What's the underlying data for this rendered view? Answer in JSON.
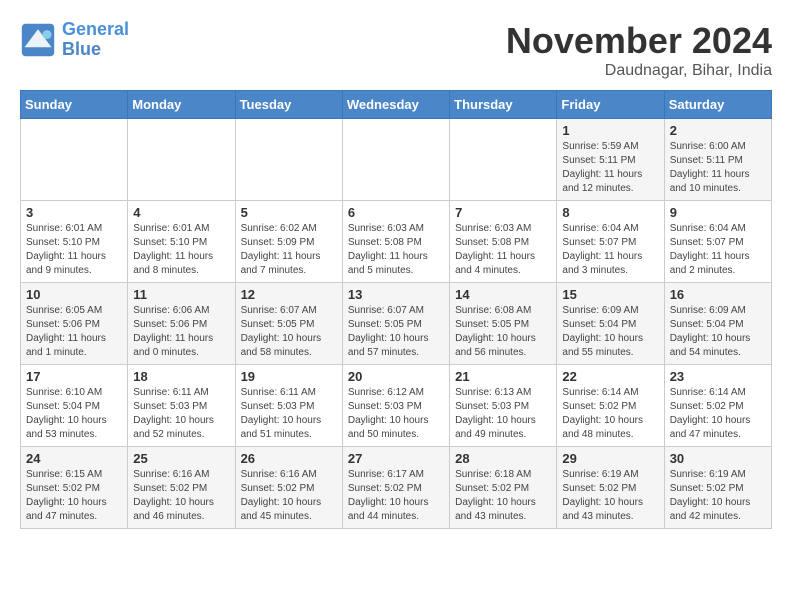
{
  "header": {
    "logo_line1": "General",
    "logo_line2": "Blue",
    "month": "November 2024",
    "location": "Daudnagar, Bihar, India"
  },
  "weekdays": [
    "Sunday",
    "Monday",
    "Tuesday",
    "Wednesday",
    "Thursday",
    "Friday",
    "Saturday"
  ],
  "weeks": [
    [
      {
        "day": "",
        "info": ""
      },
      {
        "day": "",
        "info": ""
      },
      {
        "day": "",
        "info": ""
      },
      {
        "day": "",
        "info": ""
      },
      {
        "day": "",
        "info": ""
      },
      {
        "day": "1",
        "info": "Sunrise: 5:59 AM\nSunset: 5:11 PM\nDaylight: 11 hours\nand 12 minutes."
      },
      {
        "day": "2",
        "info": "Sunrise: 6:00 AM\nSunset: 5:11 PM\nDaylight: 11 hours\nand 10 minutes."
      }
    ],
    [
      {
        "day": "3",
        "info": "Sunrise: 6:01 AM\nSunset: 5:10 PM\nDaylight: 11 hours\nand 9 minutes."
      },
      {
        "day": "4",
        "info": "Sunrise: 6:01 AM\nSunset: 5:10 PM\nDaylight: 11 hours\nand 8 minutes."
      },
      {
        "day": "5",
        "info": "Sunrise: 6:02 AM\nSunset: 5:09 PM\nDaylight: 11 hours\nand 7 minutes."
      },
      {
        "day": "6",
        "info": "Sunrise: 6:03 AM\nSunset: 5:08 PM\nDaylight: 11 hours\nand 5 minutes."
      },
      {
        "day": "7",
        "info": "Sunrise: 6:03 AM\nSunset: 5:08 PM\nDaylight: 11 hours\nand 4 minutes."
      },
      {
        "day": "8",
        "info": "Sunrise: 6:04 AM\nSunset: 5:07 PM\nDaylight: 11 hours\nand 3 minutes."
      },
      {
        "day": "9",
        "info": "Sunrise: 6:04 AM\nSunset: 5:07 PM\nDaylight: 11 hours\nand 2 minutes."
      }
    ],
    [
      {
        "day": "10",
        "info": "Sunrise: 6:05 AM\nSunset: 5:06 PM\nDaylight: 11 hours\nand 1 minute."
      },
      {
        "day": "11",
        "info": "Sunrise: 6:06 AM\nSunset: 5:06 PM\nDaylight: 11 hours\nand 0 minutes."
      },
      {
        "day": "12",
        "info": "Sunrise: 6:07 AM\nSunset: 5:05 PM\nDaylight: 10 hours\nand 58 minutes."
      },
      {
        "day": "13",
        "info": "Sunrise: 6:07 AM\nSunset: 5:05 PM\nDaylight: 10 hours\nand 57 minutes."
      },
      {
        "day": "14",
        "info": "Sunrise: 6:08 AM\nSunset: 5:05 PM\nDaylight: 10 hours\nand 56 minutes."
      },
      {
        "day": "15",
        "info": "Sunrise: 6:09 AM\nSunset: 5:04 PM\nDaylight: 10 hours\nand 55 minutes."
      },
      {
        "day": "16",
        "info": "Sunrise: 6:09 AM\nSunset: 5:04 PM\nDaylight: 10 hours\nand 54 minutes."
      }
    ],
    [
      {
        "day": "17",
        "info": "Sunrise: 6:10 AM\nSunset: 5:04 PM\nDaylight: 10 hours\nand 53 minutes."
      },
      {
        "day": "18",
        "info": "Sunrise: 6:11 AM\nSunset: 5:03 PM\nDaylight: 10 hours\nand 52 minutes."
      },
      {
        "day": "19",
        "info": "Sunrise: 6:11 AM\nSunset: 5:03 PM\nDaylight: 10 hours\nand 51 minutes."
      },
      {
        "day": "20",
        "info": "Sunrise: 6:12 AM\nSunset: 5:03 PM\nDaylight: 10 hours\nand 50 minutes."
      },
      {
        "day": "21",
        "info": "Sunrise: 6:13 AM\nSunset: 5:03 PM\nDaylight: 10 hours\nand 49 minutes."
      },
      {
        "day": "22",
        "info": "Sunrise: 6:14 AM\nSunset: 5:02 PM\nDaylight: 10 hours\nand 48 minutes."
      },
      {
        "day": "23",
        "info": "Sunrise: 6:14 AM\nSunset: 5:02 PM\nDaylight: 10 hours\nand 47 minutes."
      }
    ],
    [
      {
        "day": "24",
        "info": "Sunrise: 6:15 AM\nSunset: 5:02 PM\nDaylight: 10 hours\nand 47 minutes."
      },
      {
        "day": "25",
        "info": "Sunrise: 6:16 AM\nSunset: 5:02 PM\nDaylight: 10 hours\nand 46 minutes."
      },
      {
        "day": "26",
        "info": "Sunrise: 6:16 AM\nSunset: 5:02 PM\nDaylight: 10 hours\nand 45 minutes."
      },
      {
        "day": "27",
        "info": "Sunrise: 6:17 AM\nSunset: 5:02 PM\nDaylight: 10 hours\nand 44 minutes."
      },
      {
        "day": "28",
        "info": "Sunrise: 6:18 AM\nSunset: 5:02 PM\nDaylight: 10 hours\nand 43 minutes."
      },
      {
        "day": "29",
        "info": "Sunrise: 6:19 AM\nSunset: 5:02 PM\nDaylight: 10 hours\nand 43 minutes."
      },
      {
        "day": "30",
        "info": "Sunrise: 6:19 AM\nSunset: 5:02 PM\nDaylight: 10 hours\nand 42 minutes."
      }
    ]
  ]
}
